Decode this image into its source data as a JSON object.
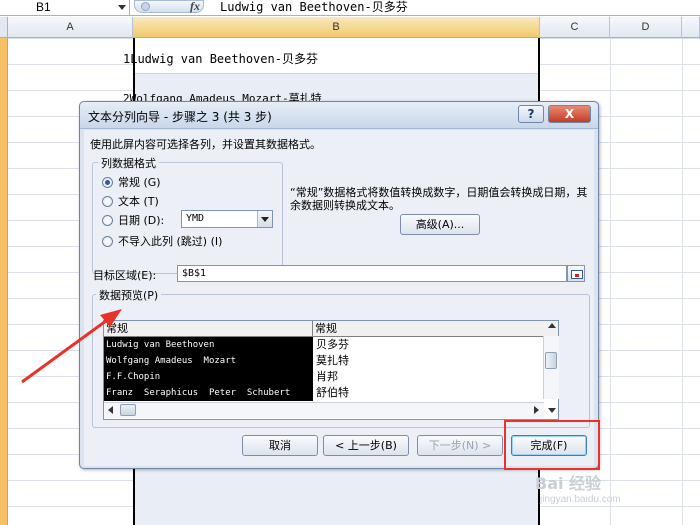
{
  "formula_bar": {
    "cell_ref": "B1",
    "fx": "fx",
    "content": "Ludwig van Beethoven-贝多芬"
  },
  "columns": [
    "A",
    "B",
    "C",
    "D"
  ],
  "cells": {
    "b1_row": "1",
    "b1": "Ludwig van Beethoven-贝多芬",
    "b2_row": "2",
    "b2": "Wolfgang Amadeus Mozart-莫扎特"
  },
  "dialog": {
    "title": "文本分列向导 - 步骤之 3 (共 3 步)",
    "help": "?",
    "close": "X",
    "instruction": "使用此屏内容可选择各列，并设置其数据格式。",
    "format_group": {
      "title": "列数据格式",
      "options": [
        "常规 (G)",
        "文本 (T)",
        "日期 (D):",
        "不导入此列 (跳过) (I)"
      ],
      "selected_index": 0,
      "date_format": "YMD"
    },
    "description": "“常规”数据格式将数值转换成数字，日期值会转换成日期，其余数据则转换成文本。",
    "advanced": "高级(A)...",
    "target_label": "目标区域(E):",
    "target_value": "$B$1",
    "preview_title": "数据预览(P)",
    "preview": {
      "headers": [
        "常规",
        "常规"
      ],
      "col1": [
        "Ludwig van Beethoven",
        "Wolfgang Amadeus  Mozart",
        "F.F.Chopin",
        "Franz  Seraphicus  Peter  Schubert"
      ],
      "col2": [
        "贝多芬",
        "莫扎特",
        "肖邦",
        "舒伯特"
      ]
    },
    "buttons": {
      "cancel": "取消",
      "back": "< 上一步(B)",
      "next": "下一步(N) >",
      "finish": "完成(F)"
    }
  },
  "watermark": {
    "text": "Bai 经验",
    "url": "jingyan.baidu.com"
  },
  "colors": {
    "annotation_red": "#e8322a",
    "row_header_orange": "#f6c165"
  }
}
